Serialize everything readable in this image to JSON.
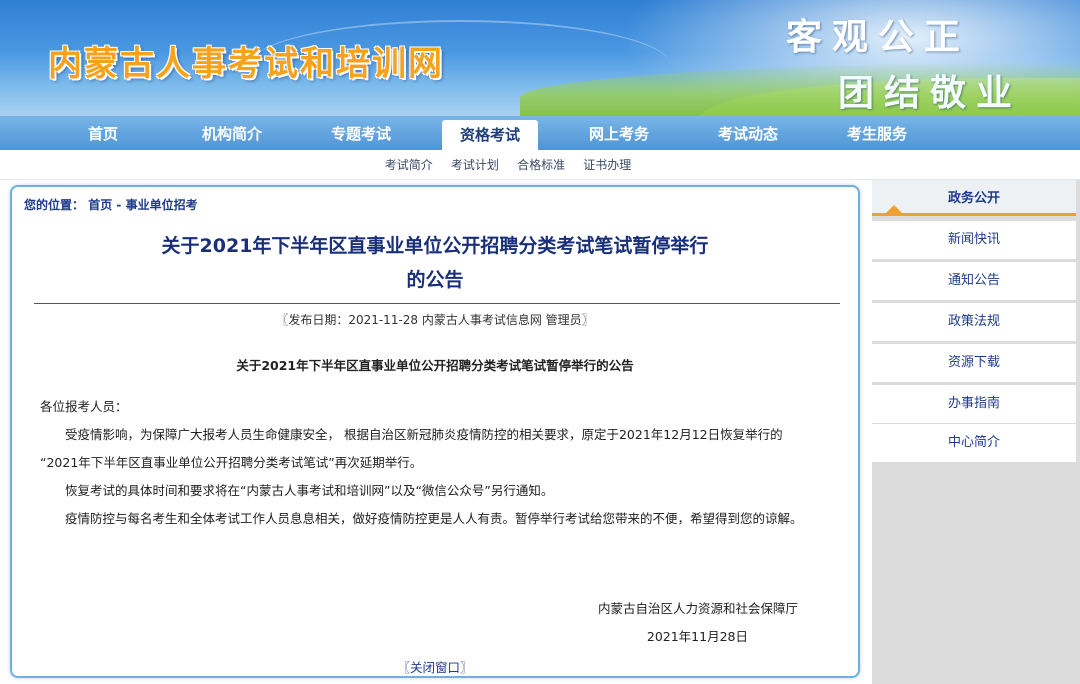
{
  "header": {
    "site_title": "内蒙古人事考试和培训网",
    "slogan_line1": "客观公正",
    "slogan_line2": "团结敬业"
  },
  "nav": {
    "items": [
      {
        "label": "首页",
        "active": false
      },
      {
        "label": "机构简介",
        "active": false
      },
      {
        "label": "专题考试",
        "active": false
      },
      {
        "label": "资格考试",
        "active": true
      },
      {
        "label": "网上考务",
        "active": false
      },
      {
        "label": "考试动态",
        "active": false
      },
      {
        "label": "考生服务",
        "active": false
      }
    ]
  },
  "subnav": {
    "items": [
      "考试简介",
      "考试计划",
      "合格标准",
      "证书办理"
    ]
  },
  "breadcrumb": {
    "prefix": "您的位置：",
    "home": "首页",
    "sep": " - ",
    "current": "事业单位招考"
  },
  "article": {
    "title_line1": "关于2021年下半年区直事业单位公开招聘分类考试笔试暂停举行",
    "title_line2": "的公告",
    "meta": "〖发布日期：2021-11-28 内蒙古人事考试信息网 管理员〗",
    "subtitle": "关于2021年下半年区直事业单位公开招聘分类考试笔试暂停举行的公告",
    "greeting": "各位报考人员：",
    "paragraphs": [
      "受疫情影响，为保障广大报考人员生命健康安全， 根据自治区新冠肺炎疫情防控的相关要求，原定于2021年12月12日恢复举行的 “2021年下半年区直事业单位公开招聘分类考试笔试”再次延期举行。",
      "恢复考试的具体时间和要求将在“内蒙古人事考试和培训网”以及“微信公众号”另行通知。",
      "疫情防控与每名考生和全体考试工作人员息息相关，做好疫情防控更是人人有责。暂停举行考试给您带来的不便，希望得到您的谅解。"
    ],
    "signature_org": "内蒙古自治区人力资源和社会保障厅",
    "signature_date": "2021年11月28日",
    "close_label": "〖关闭窗口〗"
  },
  "sidebar": {
    "header": "政务公开",
    "items": [
      "新闻快讯",
      "通知公告",
      "政策法规",
      "资源下载",
      "办事指南",
      "中心简介"
    ]
  },
  "colors": {
    "nav_blue": "#4f95d6",
    "title_blue": "#1a2f7a",
    "accent_orange": "#f0a030",
    "site_title_orange": "#f6a21c"
  }
}
